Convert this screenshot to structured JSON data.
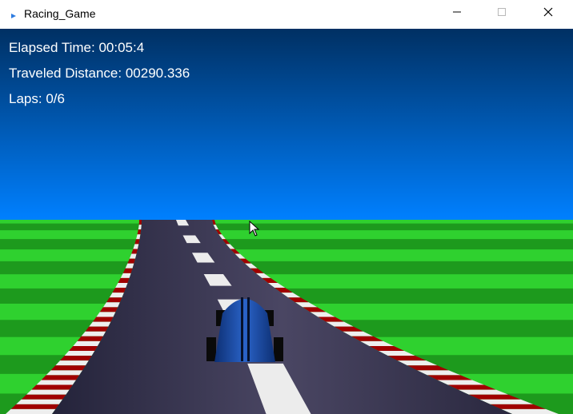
{
  "window": {
    "title": "Racing_Game",
    "controls": [
      "minimize-icon",
      "maximize-icon",
      "close-icon"
    ]
  },
  "hud": {
    "elapsed_label": "Elapsed Time:",
    "elapsed_value": "00:05:4",
    "distance_label": "Traveled Distance:",
    "distance_value": "00290.336",
    "laps_label": "Laps:",
    "laps_value": "0/6"
  },
  "colors": {
    "sky_top": "#003063",
    "sky_bottom": "#0080ff",
    "grass_light": "#2fd12f",
    "grass_dark": "#1d9a1d",
    "road": "#3a3650",
    "curb_red": "#a00000",
    "curb_white": "#eeeeee",
    "car_body": "#1b4fa8"
  }
}
